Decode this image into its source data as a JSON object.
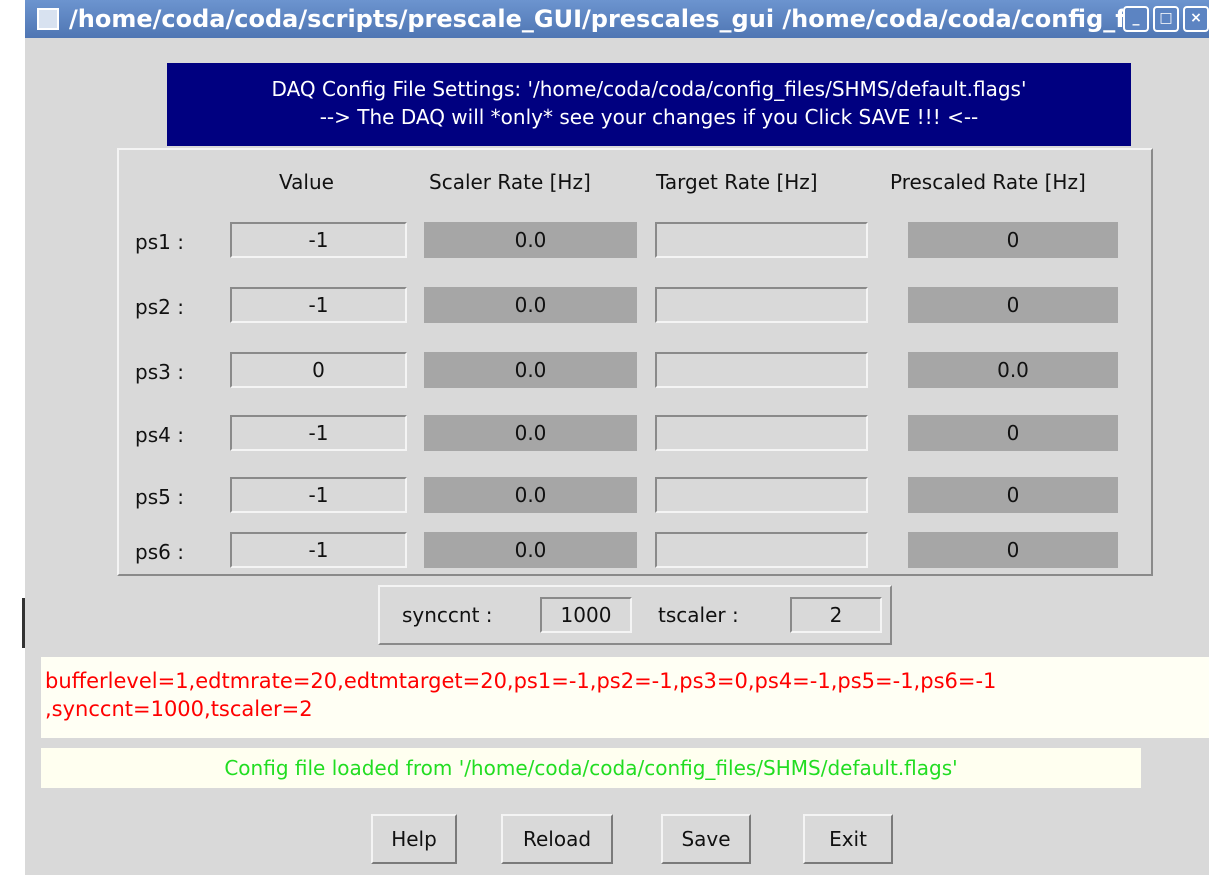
{
  "window": {
    "title": "/home/coda/coda/scripts/prescale_GUI/prescales_gui /home/coda/coda/config_files/SHMS/default.flags"
  },
  "header": {
    "line1": "DAQ Config File Settings: '/home/coda/coda/config_files/SHMS/default.flags'",
    "line2": "--> The DAQ will *only* see your changes if you Click SAVE !!! <--"
  },
  "table": {
    "columns": [
      "Value",
      "Scaler Rate [Hz]",
      "Target Rate [Hz]",
      "Prescaled Rate [Hz]"
    ],
    "rows": [
      {
        "label": "ps1 :",
        "value": "-1",
        "scaler_rate": "0.0",
        "target_rate": "",
        "prescaled_rate": "0"
      },
      {
        "label": "ps2 :",
        "value": "-1",
        "scaler_rate": "0.0",
        "target_rate": "",
        "prescaled_rate": "0"
      },
      {
        "label": "ps3 :",
        "value": "0",
        "scaler_rate": "0.0",
        "target_rate": "",
        "prescaled_rate": "0.0"
      },
      {
        "label": "ps4 :",
        "value": "-1",
        "scaler_rate": "0.0",
        "target_rate": "",
        "prescaled_rate": "0"
      },
      {
        "label": "ps5 :",
        "value": "-1",
        "scaler_rate": "0.0",
        "target_rate": "",
        "prescaled_rate": "0"
      },
      {
        "label": "ps6 :",
        "value": "-1",
        "scaler_rate": "0.0",
        "target_rate": "",
        "prescaled_rate": "0"
      }
    ]
  },
  "sync": {
    "synccnt_label": "synccnt :",
    "synccnt_value": "1000",
    "tscaler_label": "tscaler :",
    "tscaler_value": "2"
  },
  "flags": {
    "line1": "bufferlevel=1,edtmrate=20,edtmtarget=20,ps1=-1,ps2=-1,ps3=0,ps4=-1,ps5=-1,ps6=-1",
    "line2": ",synccnt=1000,tscaler=2"
  },
  "status": {
    "text": "Config file loaded from '/home/coda/coda/config_files/SHMS/default.flags'"
  },
  "buttons": {
    "help": "Help",
    "reload": "Reload",
    "save": "Save",
    "exit": "Exit"
  },
  "colors": {
    "header_bg": "#000080",
    "flags_text": "#ff0000",
    "status_text": "#22dd22",
    "readonly_bg": "#a6a6a6",
    "window_bg": "#d9d9d9"
  }
}
